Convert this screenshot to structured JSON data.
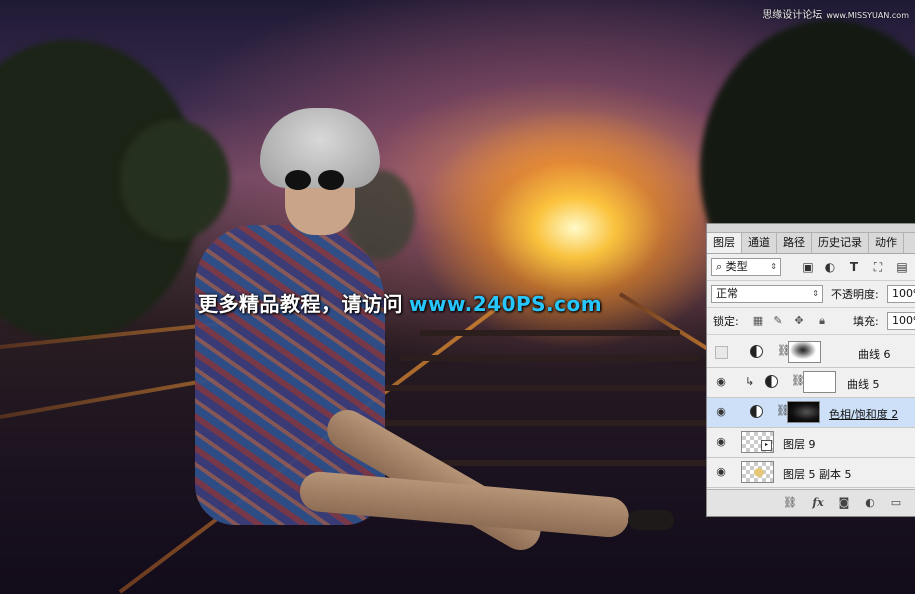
{
  "watermark": {
    "text": "思缘设计论坛",
    "site": "www.MISSYUAN.com"
  },
  "overlay": {
    "text": "更多精品教程，请访问",
    "url": "www.240PS.com"
  },
  "colors": {
    "url_blue": "#28c6ff",
    "selected_layer": "#cde0f7",
    "panel_bg": "#f0f0f0"
  },
  "layers_panel": {
    "tabs": [
      "图层",
      "通道",
      "路径",
      "历史记录",
      "动作"
    ],
    "active_tab": "图层",
    "filter": {
      "value": "类型"
    },
    "blend_mode": {
      "value": "正常"
    },
    "opacity": {
      "label": "不透明度:",
      "value": "100%"
    },
    "lock": {
      "label": "锁定:"
    },
    "fill": {
      "label": "填充:",
      "value": "100%"
    },
    "layers": [
      {
        "name": "曲线 6",
        "visible": false,
        "thumb": "curve-mask",
        "adjustment": true
      },
      {
        "name": "曲线 5",
        "visible": true,
        "clipped": true,
        "thumb": "white-mask",
        "adjustment": true
      },
      {
        "name": "色相/饱和度 2",
        "visible": true,
        "selected": true,
        "thumb": "dark-mask",
        "adjustment": true
      },
      {
        "name": "图层 9",
        "visible": true,
        "thumb": "smart-object"
      },
      {
        "name": "图层 5 副本 5",
        "visible": true,
        "thumb": "transparent"
      }
    ]
  }
}
